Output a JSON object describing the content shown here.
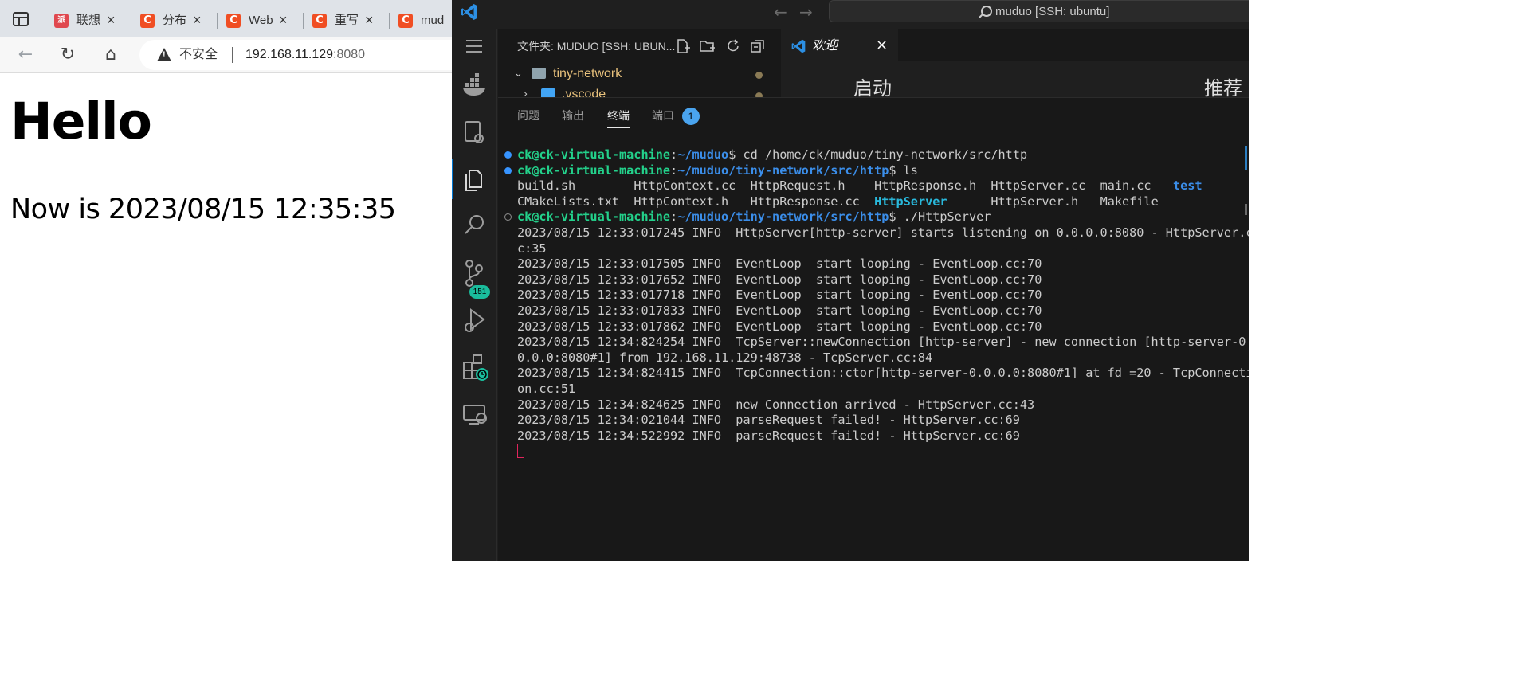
{
  "browser": {
    "tabs": [
      {
        "title": "联想",
        "icon": "csdn-like-red-icon"
      },
      {
        "title": "分布",
        "icon": "csdn-icon"
      },
      {
        "title": "Web",
        "icon": "csdn-icon"
      },
      {
        "title": "重写",
        "icon": "csdn-icon"
      },
      {
        "title": "mud",
        "icon": "csdn-icon"
      }
    ],
    "close_glyph": "×",
    "security_label": "不安全",
    "url_host": "192.168.11.129",
    "url_port": ":8080",
    "page": {
      "heading": "Hello",
      "paragraph": "Now is 2023/08/15 12:35:35"
    }
  },
  "vscode": {
    "search_text": "muduo [SSH: ubuntu]",
    "explorer_title": "文件夹: MUDUO [SSH: UBUN...",
    "tree": [
      {
        "label": "tiny-network",
        "expanded": true
      },
      {
        "label": ".vscode",
        "expanded": false
      }
    ],
    "source_control_badge": "151",
    "editor_tab": {
      "label": "欢迎",
      "close": "×"
    },
    "welcome": {
      "left_heading": "启动",
      "right_heading": "推荐"
    },
    "panel_tabs": [
      {
        "label": "问题",
        "active": false
      },
      {
        "label": "输出",
        "active": false
      },
      {
        "label": "终端",
        "active": true
      },
      {
        "label": "端口",
        "active": false
      }
    ],
    "ports_badge": "1",
    "terminal": {
      "prompt_user": "ck@ck-virtual-machine",
      "prompts": [
        {
          "path": "~/muduo",
          "cmd": " cd /home/ck/muduo/tiny-network/src/http"
        },
        {
          "path": "~/muduo/tiny-network/src/http",
          "cmd": " ls"
        },
        {
          "path": "~/muduo/tiny-network/src/http",
          "cmd": " ./HttpServer"
        }
      ],
      "ls_row1": [
        "build.sh",
        "HttpContext.cc",
        "HttpRequest.h",
        "HttpResponse.h",
        "HttpServer.cc",
        "main.cc",
        "test"
      ],
      "ls_row2": [
        "CMakeLists.txt",
        "HttpContext.h",
        "HttpResponse.cc",
        "HttpServer",
        "HttpServer.h",
        "Makefile"
      ],
      "log_lines": [
        "2023/08/15 12:33:017245 INFO  HttpServer[http-server] starts listening on 0.0.0.0:8080 - HttpServer.c",
        "c:35",
        "2023/08/15 12:33:017505 INFO  EventLoop  start looping - EventLoop.cc:70",
        "2023/08/15 12:33:017652 INFO  EventLoop  start looping - EventLoop.cc:70",
        "2023/08/15 12:33:017718 INFO  EventLoop  start looping - EventLoop.cc:70",
        "2023/08/15 12:33:017833 INFO  EventLoop  start looping - EventLoop.cc:70",
        "2023/08/15 12:33:017862 INFO  EventLoop  start looping - EventLoop.cc:70",
        "2023/08/15 12:34:824254 INFO  TcpServer::newConnection [http-server] - new connection [http-server-0.",
        "0.0.0:8080#1] from 192.168.11.129:48738 - TcpServer.cc:84",
        "2023/08/15 12:34:824415 INFO  TcpConnection::ctor[http-server-0.0.0.0:8080#1] at fd =20 - TcpConnecti",
        "on.cc:51",
        "2023/08/15 12:34:824625 INFO  new Connection arrived - HttpServer.cc:43",
        "2023/08/15 12:34:021044 INFO  parseRequest failed! - HttpServer.cc:69",
        "2023/08/15 12:34:522992 INFO  parseRequest failed! - HttpServer.cc:69"
      ]
    }
  }
}
